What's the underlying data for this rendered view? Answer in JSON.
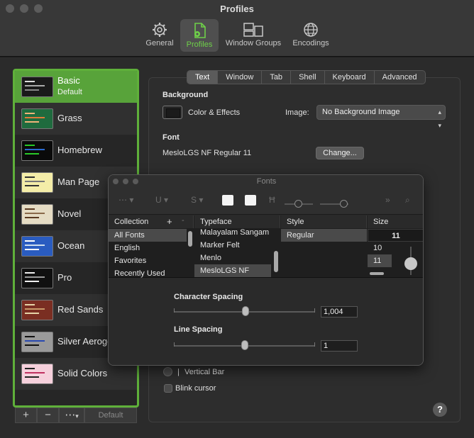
{
  "window": {
    "title": "Profiles"
  },
  "toolbar": {
    "items": [
      {
        "label": "General",
        "icon": "gear-icon"
      },
      {
        "label": "Profiles",
        "icon": "profiles-icon",
        "active": true
      },
      {
        "label": "Window Groups",
        "icon": "window-groups-icon"
      },
      {
        "label": "Encodings",
        "icon": "globe-icon"
      }
    ]
  },
  "profiles": [
    {
      "name": "Basic",
      "sub": "Default",
      "selected": true,
      "bg": "#1a1a1a",
      "fg": "#dddddd"
    },
    {
      "name": "Grass",
      "bg": "#1f6b3e",
      "fg": "#f0b37a"
    },
    {
      "name": "Homebrew",
      "bg": "#0a0a0a",
      "fg": "#28c828"
    },
    {
      "name": "Man Page",
      "bg": "#f4eda8",
      "fg": "#222222"
    },
    {
      "name": "Novel",
      "bg": "#e5dcc4",
      "fg": "#5a3a20"
    },
    {
      "name": "Ocean",
      "bg": "#2a5cc0",
      "fg": "#ffffff"
    },
    {
      "name": "Pro",
      "bg": "#101010",
      "fg": "#eeeeee"
    },
    {
      "name": "Red Sands",
      "bg": "#7a2e22",
      "fg": "#e6d4a8"
    },
    {
      "name": "Silver Aerogel",
      "bg": "#9a9a9a",
      "fg": "#111111"
    },
    {
      "name": "Solid Colors",
      "bg": "#f6d0dc",
      "fg": "#222222"
    }
  ],
  "sidebar_footer": {
    "add": "+",
    "remove": "−",
    "more": "⋯",
    "default_label": "Default"
  },
  "tabs": [
    "Text",
    "Window",
    "Tab",
    "Shell",
    "Keyboard",
    "Advanced"
  ],
  "active_tab": "Text",
  "settings": {
    "background_heading": "Background",
    "color_effects": "Color & Effects",
    "image_label": "Image:",
    "image_value": "No Background Image",
    "font_heading": "Font",
    "font_value": "MesloLGS NF Regular 11",
    "change_button": "Change...",
    "cursor_option": "Vertical Bar",
    "cursor_prefix": "|",
    "blink_label": "Blink cursor",
    "help": "?"
  },
  "fonts_panel": {
    "title": "Fonts",
    "col_collection": "Collection",
    "col_typeface": "Typeface",
    "col_style": "Style",
    "col_size": "Size",
    "collections": [
      "All Fonts",
      "English",
      "Favorites",
      "Recently Used"
    ],
    "typefaces": [
      "Malayalam Sangam",
      "Marker Felt",
      "Menlo",
      "MesloLGS NF"
    ],
    "styles": [
      "Regular"
    ],
    "size_value": "11",
    "sizes": [
      "10",
      "11"
    ],
    "add": "+",
    "remove": "-",
    "character_spacing_label": "Character Spacing",
    "character_spacing_value": "1,004",
    "line_spacing_label": "Line Spacing",
    "line_spacing_value": "1"
  },
  "colors": {
    "accent": "#5fb03a",
    "active_tab_text": "#6fd049"
  }
}
